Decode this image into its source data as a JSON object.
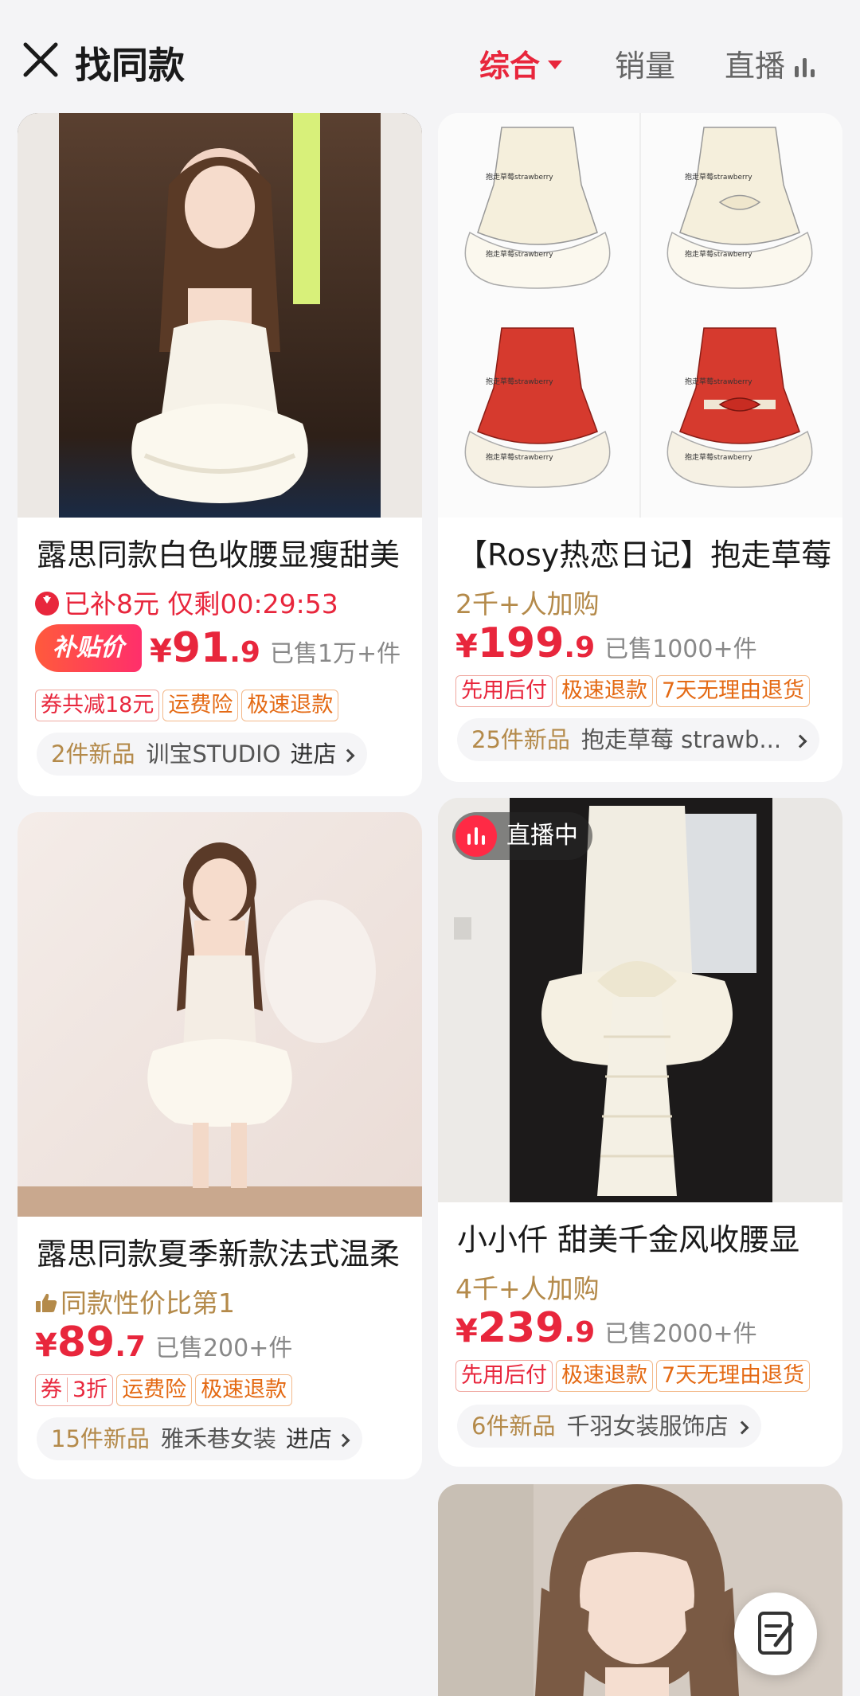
{
  "header": {
    "title": "找同款",
    "tabs": {
      "sort": "综合",
      "sales": "销量",
      "live": "直播"
    }
  },
  "products": [
    {
      "title": "露思同款白色收腰显瘦甜美",
      "subsidy_line": "已补8元 仅剩00:29:53",
      "subsidy_pill": "补贴价",
      "price_symbol": "¥",
      "price_int": "91",
      "price_dec": ".9",
      "sold": "已售1万+件",
      "tags": [
        "券共减18元",
        "运费险",
        "极速退款"
      ],
      "shop_new": "2件新品",
      "shop_name": "训宝STUDIO",
      "shop_enter": "进店"
    },
    {
      "title": "【Rosy热恋日记】抱走草莓",
      "subline": "2千+人加购",
      "price_symbol": "¥",
      "price_int": "199",
      "price_dec": ".9",
      "sold": "已售1000+件",
      "tags": [
        "先用后付",
        "极速退款",
        "7天无理由退货"
      ],
      "shop_new": "25件新品",
      "shop_name": "抱走草莓 strawb...",
      "image_watermark": "抱走草莓strawberry"
    },
    {
      "title": "露思同款夏季新款法式温柔",
      "subline": "同款性价比第1",
      "price_symbol": "¥",
      "price_int": "89",
      "price_dec": ".7",
      "sold": "已售200+件",
      "coupon_label": "券",
      "coupon_value": "3折",
      "tags": [
        "运费险",
        "极速退款"
      ],
      "shop_new": "15件新品",
      "shop_name": "雅禾巷女装",
      "shop_enter": "进店"
    },
    {
      "badge": "直播中",
      "title": "小小仟 甜美千金风收腰显",
      "subline": "4千+人加购",
      "price_symbol": "¥",
      "price_int": "239",
      "price_dec": ".9",
      "sold": "已售2000+件",
      "tags": [
        "先用后付",
        "极速退款",
        "7天无理由退货"
      ],
      "shop_new": "6件新品",
      "shop_name": "千羽女装服饰店"
    }
  ],
  "colors": {
    "accent": "#e8263c",
    "gold": "#b48a4a",
    "background": "#f4f4f6"
  },
  "icons": [
    "close-icon",
    "caret-down-icon",
    "live-bars-icon",
    "arrow-down-circle-icon",
    "thumbs-up-icon",
    "chevron-right-icon",
    "edit-note-icon"
  ]
}
